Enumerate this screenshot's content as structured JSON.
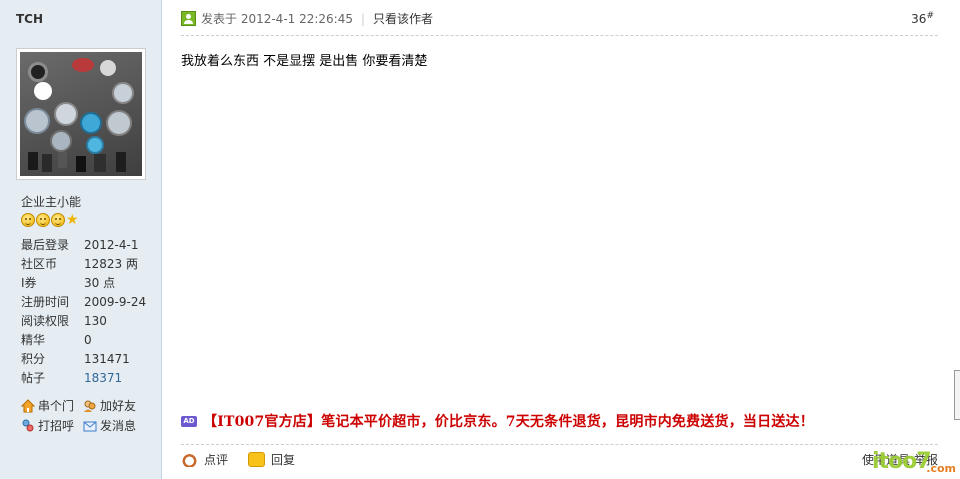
{
  "user": {
    "name": "TCH",
    "rank_title": "企业主小能",
    "stats": [
      {
        "key": "最后登录",
        "value": "2012-4-1"
      },
      {
        "key": "社区币",
        "value": "12823 两"
      },
      {
        "key": "I券",
        "value": "30 点"
      },
      {
        "key": "注册时间",
        "value": "2009-9-24"
      },
      {
        "key": "阅读权限",
        "value": "130"
      },
      {
        "key": "精华",
        "value": "0"
      },
      {
        "key": "积分",
        "value": "131471"
      },
      {
        "key": "帖子",
        "value": "18371"
      }
    ],
    "actions": {
      "visit": "串个门",
      "add_friend": "加好友",
      "greet": "打招呼",
      "message": "发消息"
    }
  },
  "post": {
    "time": "发表于 2012-4-1 22:26:45",
    "only_author": "只看该作者",
    "floor": "36",
    "floor_mark": "#",
    "content": "我放着么东西 不是显摆 是出售 你要看清楚"
  },
  "ad": {
    "badge": "AD",
    "text": "【IT007官方店】笔记本平价超市，价比京东。7天无条件退货，昆明市内免费送货，当日送达！"
  },
  "footer": {
    "comment": "点评",
    "reply": "回复",
    "use_tool": "使用道具",
    "report": "举报"
  },
  "watermark": {
    "main": "itoo7",
    "suffix": ".com"
  },
  "colors": {
    "sidebar_bg": "#e5edf2",
    "ad_red": "#cc0000",
    "link_blue": "#336699"
  }
}
